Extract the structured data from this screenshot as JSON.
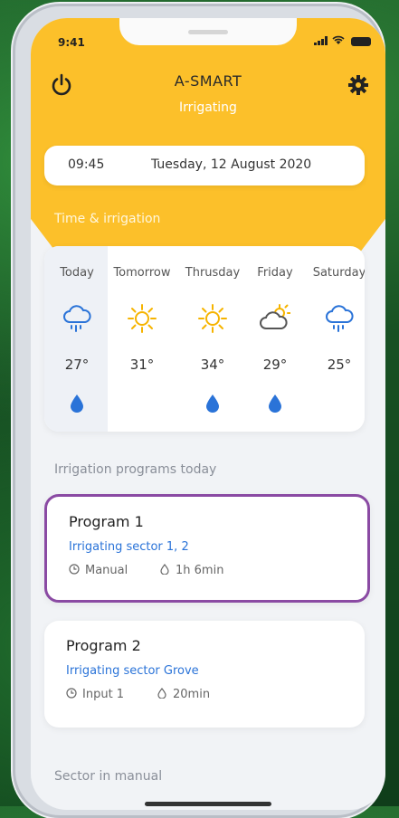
{
  "status_bar": {
    "time": "9:41"
  },
  "header": {
    "title": "A-SMART",
    "status": "Irrigating",
    "time": "09:45",
    "date": "Tuesday, 12 August 2020"
  },
  "sections": {
    "time_irrigation": "Time & irrigation",
    "programs_today": "Irrigation programs today",
    "sector_manual": "Sector in manual"
  },
  "forecast": [
    {
      "day": "Today",
      "icon": "rain-cloud-icon",
      "temp": "27°",
      "irrigation": true
    },
    {
      "day": "Tomorrow",
      "icon": "sun-icon",
      "temp": "31°",
      "irrigation": false
    },
    {
      "day": "Thrusday",
      "icon": "sun-icon",
      "temp": "34°",
      "irrigation": true
    },
    {
      "day": "Friday",
      "icon": "sun-cloud-icon",
      "temp": "29°",
      "irrigation": true
    },
    {
      "day": "Saturday",
      "icon": "rain-cloud-icon",
      "temp": "25°",
      "irrigation": false
    }
  ],
  "programs": [
    {
      "name": "Program 1",
      "sector": "Irrigating sector 1, 2",
      "trigger": "Manual",
      "duration": "1h 6min",
      "active": true
    },
    {
      "name": "Program 2",
      "sector": "Irrigating sector Grove",
      "trigger": "Input 1",
      "duration": "20min",
      "active": false
    }
  ],
  "colors": {
    "accent": "#fcc02a",
    "link": "#2a73d8",
    "active_border": "#8a4aa3",
    "drop": "#2a73d8"
  }
}
